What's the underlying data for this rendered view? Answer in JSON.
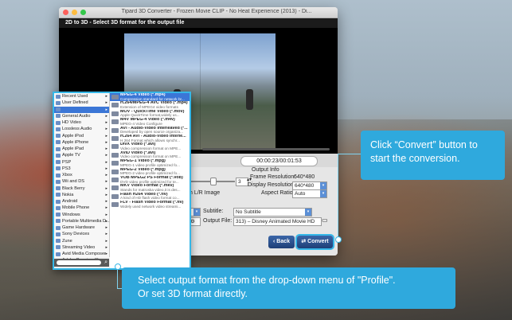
{
  "colors": {
    "accent": "#35b7e8",
    "callout_bg": "#2fa9dd",
    "selection": "#3b76d6"
  },
  "window": {
    "title": "Tipard 3D Converter - Frozen Movie CLIP - No Heat Experience (2013) - Di...",
    "step_title": "2D to 3D - Select 3D format for the output file"
  },
  "player": {
    "time": "00:00:23/00:01:53",
    "progress": 0
  },
  "settings": {
    "depth_value": "3",
    "switch_lr_label": "h L/R Image",
    "output_info_title": "Output Info",
    "frame_resolution_label": "Frame Resolution:",
    "frame_resolution_value": "640*480",
    "display_resolution_label": "Display Resolution:",
    "display_resolution_value": "640*480",
    "aspect_ratio_label": "Aspect Ratio:",
    "aspect_ratio_value": "Auto",
    "subtitle_label": "Subtitle:",
    "subtitle_value": "No Subtitle",
    "output_file_label": "Output File:",
    "output_file_value": "313) – Disney Animated Movie HD"
  },
  "buttons": {
    "back": "Back",
    "convert": "Convert",
    "back_icon": "chevron-left-icon",
    "convert_icon": "convert-arrows-icon"
  },
  "profile_dropdown": {
    "categories": [
      {
        "label": "Recent Used",
        "has_submenu": true
      },
      {
        "label": "User Defined",
        "has_submenu": true
      },
      {
        "label": "",
        "has_submenu": true,
        "active": true
      },
      {
        "label": "General Audio",
        "has_submenu": true
      },
      {
        "label": "HD Video",
        "has_submenu": true
      },
      {
        "label": "Lossless Audio",
        "has_submenu": true
      },
      {
        "label": "Apple iPod",
        "has_submenu": true
      },
      {
        "label": "Apple iPhone",
        "has_submenu": true
      },
      {
        "label": "Apple iPad",
        "has_submenu": true
      },
      {
        "label": "Apple TV",
        "has_submenu": true
      },
      {
        "label": "PSP",
        "has_submenu": true
      },
      {
        "label": "PS3",
        "has_submenu": true
      },
      {
        "label": "Xbox",
        "has_submenu": true
      },
      {
        "label": "Wii and DS",
        "has_submenu": true
      },
      {
        "label": "Black Berry",
        "has_submenu": true
      },
      {
        "label": "Nokia",
        "has_submenu": true
      },
      {
        "label": "Android",
        "has_submenu": true
      },
      {
        "label": "Mobile Phone",
        "has_submenu": true
      },
      {
        "label": "Windows",
        "has_submenu": true
      },
      {
        "label": "Portable Multimedia D...",
        "has_submenu": true
      },
      {
        "label": "Game Hardware",
        "has_submenu": true
      },
      {
        "label": "Sony Devices",
        "has_submenu": true
      },
      {
        "label": "Zune",
        "has_submenu": true
      },
      {
        "label": "Streaming Video",
        "has_submenu": true
      },
      {
        "label": "Avid Media Composer",
        "has_submenu": true
      },
      {
        "label": "Adobe Premiere/Sony...",
        "has_submenu": true
      }
    ],
    "formats": [
      {
        "name": "MPEG-4 Video (*.mp4)",
        "desc": "Compression standard for network br...",
        "active": true
      },
      {
        "name": "H.264/MPEG-4 AVC Video (*.mp4)",
        "desc": "Extension of MPEG4 video formats"
      },
      {
        "name": "MOV - QuickTime Video (*.mov)",
        "desc": "Apple QuickTime format,widely us..."
      },
      {
        "name": "M4V MPEG-4 Video (*.m4v)",
        "desc": "MPEG-4 Video Configure"
      },
      {
        "name": "AVI - Audio-Video Interleaved (*...",
        "desc": "Developed by open source organiza..."
      },
      {
        "name": "H.264 AVI - Audio-Video Interle...",
        "desc": "H.264 Format which allows synchr..."
      },
      {
        "name": "DivX Video (*.avi)",
        "desc": "Video compression format on MPE..."
      },
      {
        "name": "XviD Video (*.avi)",
        "desc": "Video compression format on MPE..."
      },
      {
        "name": "MPEG-1 Video (*.mpg)",
        "desc": "MPEG-1 video profile optimized fo..."
      },
      {
        "name": "MPEG-2 Video (*.mpg)",
        "desc": "MPEG-2 video profile optimized fo..."
      },
      {
        "name": "VOB MPEG2 PS Format (*.vob)",
        "desc": "DVD video profile optimized for te..."
      },
      {
        "name": "MKV Video Format (*.mkv)",
        "desc": "Stands for matroska video,it is des..."
      },
      {
        "name": "Flash H264 Video (*.flv)",
        "desc": "A kind of HD flash video format co..."
      },
      {
        "name": "FLV - Flash Video Format (*.flv)",
        "desc": "Widely used network video streami..."
      }
    ]
  },
  "callouts": {
    "convert_tip": "Click “Convert” button to start the conversion.",
    "profile_tip_line1": "Select output format from the drop-down menu of \"Profile\".",
    "profile_tip_line2": "Or set 3D format directly."
  }
}
